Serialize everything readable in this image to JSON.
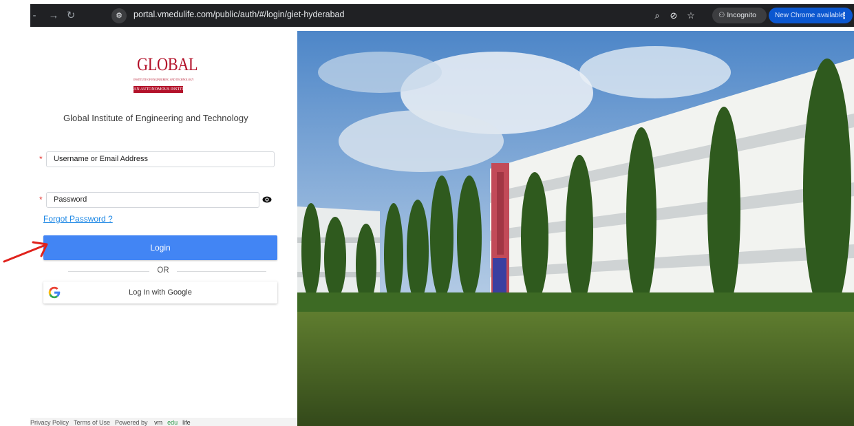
{
  "browser": {
    "url": "portal.vmedulife.com/public/auth/#/login/giet-hyderabad",
    "incognito_label": "Incognito",
    "update_label": "New Chrome available",
    "icons": [
      "forward-arrow-icon",
      "reload-icon",
      "site-settings-icon",
      "zoom-icon",
      "eye-off-icon",
      "star-icon",
      "incognito-icon",
      "more-vert-icon"
    ]
  },
  "logo": {
    "word": "GLOBAL",
    "subtitle": "INSTITUTE OF ENGINEERING AND TECHNOLOGY",
    "band": "AN AUTONOMOUS INSTITUTION"
  },
  "institution_name": "Global Institute of Engineering and Technology",
  "form": {
    "username_value": "Username or Email Address",
    "password_value": "Password",
    "required_marker": "*",
    "forgot_label": "Forgot Password ?",
    "login_label": "Login",
    "or_label": "OR",
    "google_label": "Log In with Google"
  },
  "footer": {
    "privacy": "Privacy Policy",
    "terms": "Terms of Use",
    "powered_by": "Powered by",
    "brand_a": "vm",
    "brand_b": "edu",
    "brand_c": "life"
  },
  "colors": {
    "primary": "#4285f4",
    "logo_red": "#b3122a",
    "required": "#e53935",
    "link": "#1e88e5",
    "annotation_arrow": "#e0221c"
  }
}
